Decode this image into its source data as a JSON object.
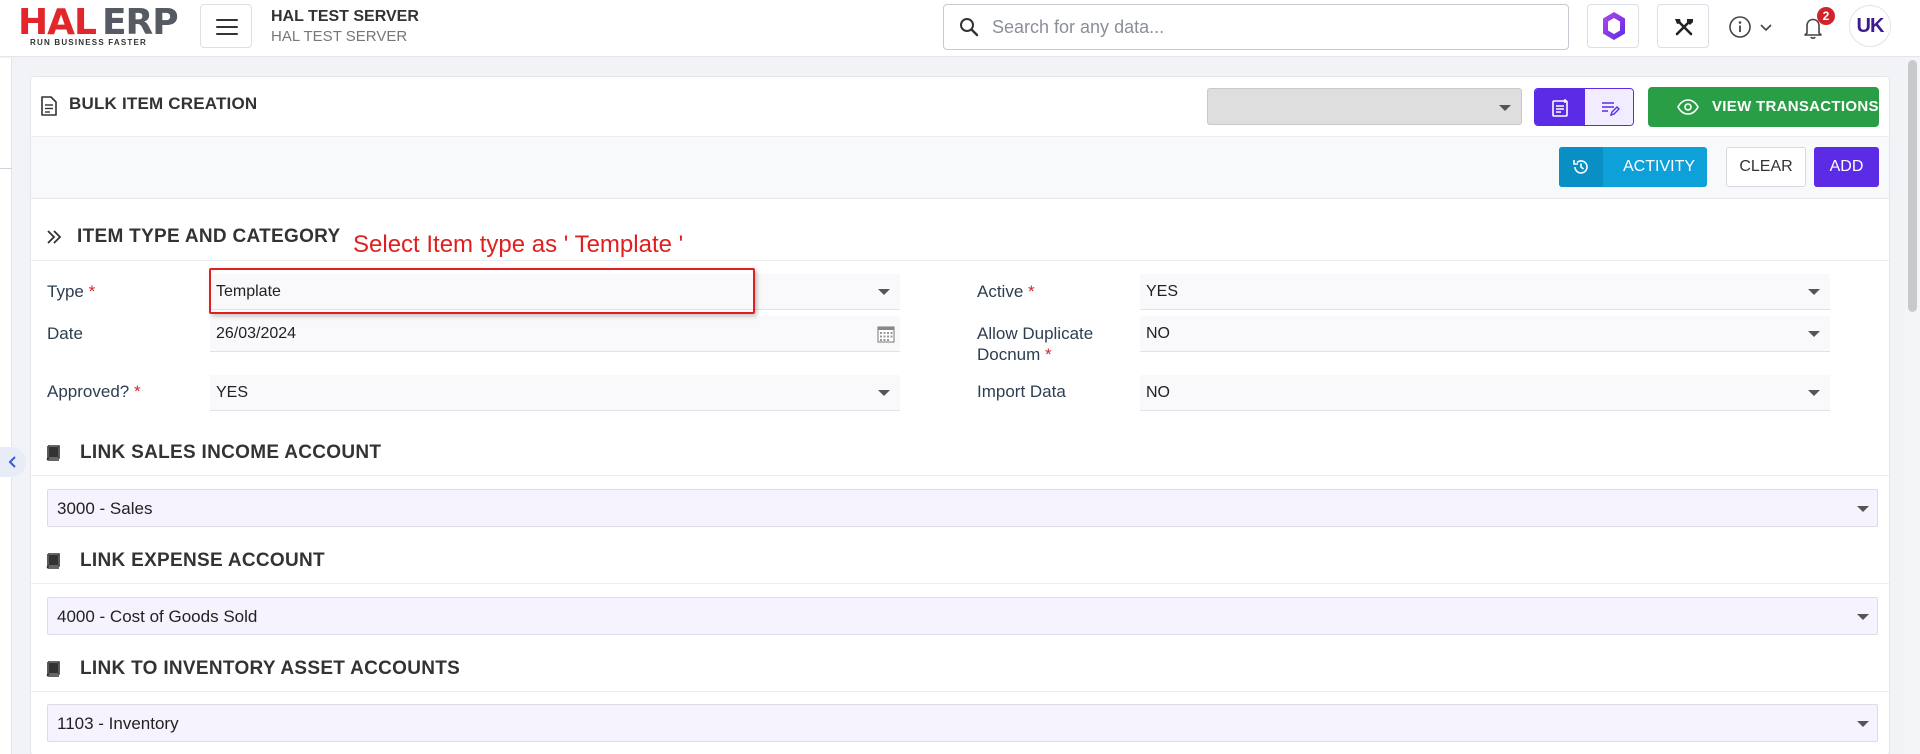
{
  "app": {
    "logo_primary": "HAL",
    "logo_secondary": "ERP",
    "logo_tagline": "RUN BUSINESS FASTER",
    "server_name": "HAL TEST SERVER",
    "server_sub": "HAL TEST SERVER",
    "search_placeholder": "Search for any data...",
    "notification_count": "2",
    "avatar_initials": "UK"
  },
  "page": {
    "title": "BULK ITEM CREATION",
    "header_select_value": "",
    "view_transactions_label": "VIEW TRANSACTIONS",
    "activity_label": "ACTIVITY",
    "clear_label": "CLEAR",
    "add_label": "ADD"
  },
  "item_type_section": {
    "title": "ITEM TYPE AND CATEGORY",
    "fields": {
      "type": {
        "label": "Type",
        "required": "*",
        "value": "Template"
      },
      "date": {
        "label": "Date",
        "value": "26/03/2024"
      },
      "approved": {
        "label": "Approved?",
        "required": "*",
        "value": "YES"
      },
      "active": {
        "label": "Active",
        "required": "*",
        "value": "YES"
      },
      "allow_duplicate": {
        "label_line1": "Allow Duplicate",
        "label_line2": "Docnum",
        "required": "*",
        "value": "NO"
      },
      "import_data": {
        "label": "Import Data",
        "value": "NO"
      }
    }
  },
  "annotation": {
    "text": "Select Item type as ' Template '",
    "color": "#e02020"
  },
  "link_sections": [
    {
      "title": "LINK SALES INCOME ACCOUNT",
      "value": "3000 - Sales"
    },
    {
      "title": "LINK EXPENSE ACCOUNT",
      "value": "4000 - Cost of Goods Sold"
    },
    {
      "title": "LINK TO INVENTORY ASSET ACCOUNTS",
      "value": "1103 - Inventory"
    }
  ],
  "colors": {
    "brand_red": "#e3262b",
    "primary_purple": "#5b2be6",
    "success_green": "#2a9e46",
    "info_blue": "#0ea0d8"
  }
}
